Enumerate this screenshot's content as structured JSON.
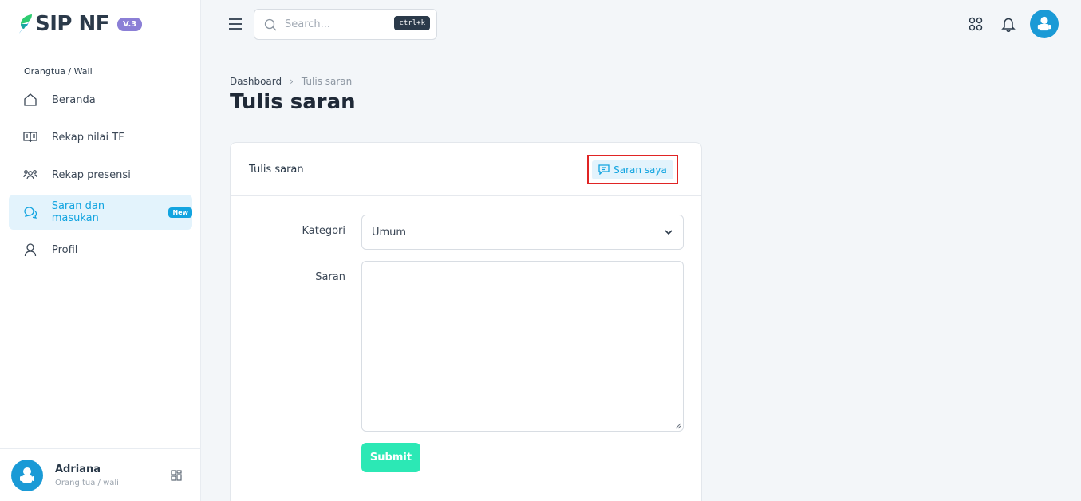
{
  "app": {
    "name": "SIP NF",
    "version": "V.3"
  },
  "sidebar": {
    "role_label": "Orangtua / Wali",
    "items": [
      {
        "label": "Beranda",
        "icon": "home-icon"
      },
      {
        "label": "Rekap nilai TF",
        "icon": "book-icon"
      },
      {
        "label": "Rekap presensi",
        "icon": "users-icon"
      },
      {
        "label": "Saran dan masukan",
        "icon": "chat-icon",
        "badge": "New",
        "active": true
      },
      {
        "label": "Profil",
        "icon": "user-icon"
      }
    ],
    "user": {
      "name": "Adriana",
      "role": "Orang tua / wali"
    }
  },
  "topbar": {
    "search_placeholder": "Search...",
    "search_shortcut": "ctrl+k"
  },
  "breadcrumb": {
    "root": "Dashboard",
    "current": "Tulis saran"
  },
  "page": {
    "title": "Tulis saran"
  },
  "card": {
    "title": "Tulis saran",
    "action_label": "Saran saya",
    "form": {
      "category_label": "Kategori",
      "category_value": "Umum",
      "saran_label": "Saran",
      "saran_value": "",
      "submit_label": "Submit"
    }
  },
  "colors": {
    "accent": "#12a4e0",
    "active_bg": "#e3f3fc",
    "submit": "#2ce8b5",
    "version_badge": "#8b7fd6",
    "highlight_border": "#e02424"
  }
}
